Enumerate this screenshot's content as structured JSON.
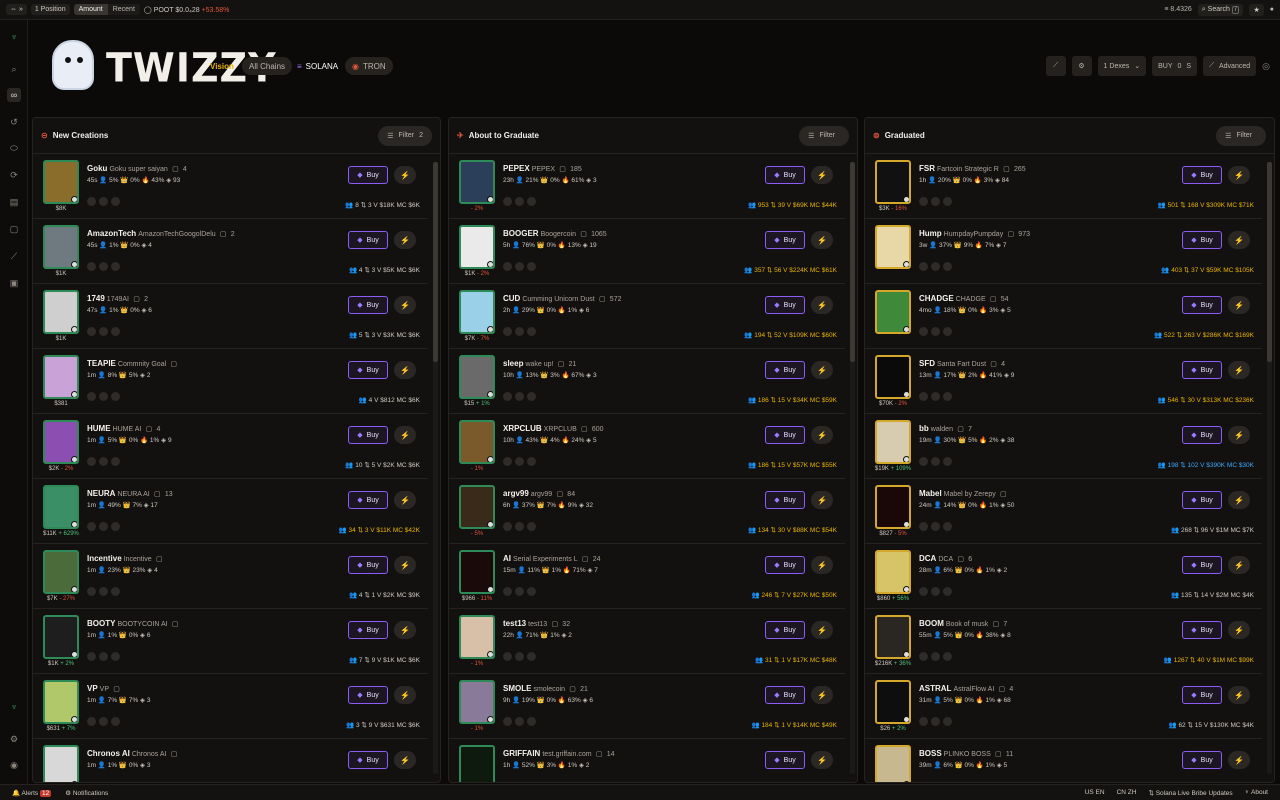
{
  "topbar": {
    "positions": "1 Position",
    "seg_amount": "Amount",
    "seg_recent": "Recent",
    "ticker": "POOT $0.0₄28",
    "ticker_change": "+53.58%",
    "balance": "8.4326",
    "search": "Search",
    "search_key": "/"
  },
  "brand": {
    "title": "TWIZZY",
    "sub": "Vision"
  },
  "chains": {
    "all": "All Chains",
    "sol": "SOLANA",
    "tron": "TRON"
  },
  "controls": {
    "dexes": "1  Dexes",
    "buy": "BUY",
    "amount": "0",
    "unit": "S",
    "advanced": "Advanced"
  },
  "columns": [
    {
      "title": "New Creations",
      "filter": "Filter",
      "filter_count": "2",
      "cards": [
        {
          "ticker": "Goku",
          "name": "Goku super saiyan",
          "holders": "4",
          "stats": "45s  👤 5%  👑 0%  🔥 43%  ◈ 93",
          "price": "$8K",
          "chg": "",
          "metrics": "👥 8  ⇅ 3  V $18K  MC $6K",
          "thumb": "#8a6d2a",
          "mcc": ""
        },
        {
          "ticker": "AmazonTech",
          "name": "AmazonTechGoogolDelu",
          "holders": "2",
          "stats": "45s  👤 1%  👑 0%  ◈ 4",
          "price": "$1K",
          "chg": "",
          "metrics": "👥 4  ⇅ 3  V $5K  MC $6K",
          "thumb": "#6e7a80",
          "mcc": ""
        },
        {
          "ticker": "1749",
          "name": "1749AI",
          "holders": "2",
          "stats": "47s  👤 1%  👑 0%  ◈ 6",
          "price": "$1K",
          "chg": "",
          "metrics": "👥 5  ⇅ 3  V $3K  MC $6K",
          "thumb": "#cfcfcf",
          "mcc": ""
        },
        {
          "ticker": "TEAPIE",
          "name": "Commnity Goal",
          "holders": "",
          "stats": "1m  👤 8%  👑 5%  ◈ 2",
          "price": "$381",
          "chg": "",
          "metrics": "👥 4  V $812  MC $6K",
          "thumb": "#c9a3d8",
          "mcc": ""
        },
        {
          "ticker": "HUME",
          "name": "HUME AI",
          "holders": "4",
          "stats": "1m  👤 5%  👑 0%  🔥 1%  ◈ 9",
          "price": "$2K",
          "chg": "- 2%",
          "metrics": "👥 10  ⇅ 5  V $2K  MC $6K",
          "thumb": "#8a4fb0",
          "mcc": ""
        },
        {
          "ticker": "NEURA",
          "name": "NEURA AI",
          "holders": "13",
          "stats": "1m  👤 49%  👑 7%  ◈ 17",
          "price": "$11K",
          "chg": "+ 629%",
          "metrics": "👥 34  ⇅ 3  V $11K  MC $42K",
          "thumb": "#3a8f66",
          "mcc": "gold"
        },
        {
          "ticker": "Incentive",
          "name": "Incentive",
          "holders": "",
          "stats": "1m  👤 23%  👑 23%  ◈ 4",
          "price": "$7K",
          "chg": "- 27%",
          "metrics": "👥 4  ⇅ 1  V $2K  MC $9K",
          "thumb": "#4c6b3a",
          "mcc": ""
        },
        {
          "ticker": "BOOTY",
          "name": "BOOTYCOIN AI",
          "holders": "",
          "stats": "1m  👤 1%  👑 0%  ◈ 6",
          "price": "$1K",
          "chg": "+ 2%",
          "metrics": "👥 7  ⇅ 9  V $1K  MC $6K",
          "thumb": "#1e1e1e",
          "mcc": ""
        },
        {
          "ticker": "VP",
          "name": "VP",
          "holders": "",
          "stats": "1m  👤 7%  👑 7%  ◈ 3",
          "price": "$631",
          "chg": "+ 7%",
          "metrics": "👥 3  ⇅ 9  V $631  MC $6K",
          "thumb": "#b0c86a",
          "mcc": ""
        },
        {
          "ticker": "Chronos AI",
          "name": "Chronos AI",
          "holders": "",
          "stats": "1m  👤 1%  👑 0%  ◈ 3",
          "price": "",
          "chg": "",
          "metrics": "",
          "thumb": "#d8d8d8",
          "mcc": ""
        }
      ]
    },
    {
      "title": "About to Graduate",
      "filter": "Filter",
      "filter_count": "",
      "cards": [
        {
          "ticker": "PEPEX",
          "name": "PEPEX",
          "holders": "185",
          "stats": "23h  👤 21%  👑 0%  🔥 61%  ◈ 3",
          "price": "",
          "chg": "- 2%",
          "metrics": "👥 953  ⇅ 39  V $69K  MC $44K",
          "thumb": "#2b3f5a",
          "mcc": "gold"
        },
        {
          "ticker": "BOOGER",
          "name": "Boogercoin",
          "holders": "1065",
          "stats": "5h  👤 76%  👑 0%  🔥 13%  ◈ 19",
          "price": "$1K",
          "chg": "- 2%",
          "metrics": "👥 357  ⇅ 56  V $224K  MC $61K",
          "thumb": "#eaeaea",
          "mcc": "gold"
        },
        {
          "ticker": "CUD",
          "name": "Cumming Unicorn Dust",
          "holders": "572",
          "stats": "2h  👤 29%  👑 0%  🔥 1%  ◈ 6",
          "price": "$7K",
          "chg": "- 7%",
          "metrics": "👥 194  ⇅ 52  V $109K  MC $60K",
          "thumb": "#9ad0e8",
          "mcc": "gold"
        },
        {
          "ticker": "sleep",
          "name": "wake up!",
          "holders": "21",
          "stats": "10h  👤 13%  👑 3%  🔥 67%  ◈ 3",
          "price": "$15",
          "chg": "+ 1%",
          "metrics": "👥 186  ⇅ 15  V $34K  MC $59K",
          "thumb": "#6a6a6a",
          "mcc": "gold"
        },
        {
          "ticker": "XRPCLUB",
          "name": "XRPCLUB",
          "holders": "600",
          "stats": "10h  👤 43%  👑 4%  🔥 24%  ◈ 5",
          "price": "",
          "chg": "- 1%",
          "metrics": "👥 186  ⇅ 15  V $57K  MC $55K",
          "thumb": "#7a5a2a",
          "mcc": "gold"
        },
        {
          "ticker": "argv99",
          "name": "argv99",
          "holders": "84",
          "stats": "6h  👤 37%  👑 7%  🔥 9%  ◈ 32",
          "price": "",
          "chg": "- 5%",
          "metrics": "👥 134  ⇅ 30  V $88K  MC $54K",
          "thumb": "#3a2a1a",
          "mcc": "gold"
        },
        {
          "ticker": "AI",
          "name": "Serial Experiments L",
          "holders": "24",
          "stats": "15m  👤 11%  👑 1%  🔥 71%  ◈ 7",
          "price": "$966",
          "chg": "- 11%",
          "metrics": "👥 246  ⇅ 7  V $27K  MC $50K",
          "thumb": "#1a0a0a",
          "mcc": "gold"
        },
        {
          "ticker": "test13",
          "name": "test13",
          "holders": "32",
          "stats": "22h  👤 71%  👑 1%  ◈ 2",
          "price": "",
          "chg": "- 1%",
          "metrics": "👥 31  ⇅ 1  V $17K  MC $48K",
          "thumb": "#d8c0a8",
          "mcc": "gold"
        },
        {
          "ticker": "SMOLE",
          "name": "smolecoin",
          "holders": "21",
          "stats": "9h  👤 19%  👑 0%  🔥 63%  ◈ 6",
          "price": "",
          "chg": "- 1%",
          "metrics": "👥 184  ⇅ 1  V $14K  MC $49K",
          "thumb": "#8a7a9a",
          "mcc": "gold"
        },
        {
          "ticker": "GRIFFAIN",
          "name": "test.griffain.com",
          "holders": "14",
          "stats": "1h  👤 52%  👑 3%  🔥 1%  ◈ 2",
          "price": "",
          "chg": "",
          "metrics": "",
          "thumb": "#0e1a0e",
          "mcc": ""
        }
      ]
    },
    {
      "title": "Graduated",
      "filter": "Filter",
      "filter_count": "",
      "cards": [
        {
          "ticker": "FSR",
          "name": "Fartcoin Strategic R",
          "holders": "265",
          "stats": "1h  👤 20%  👑 0%  🔥 3%  ◈ 84",
          "price": "$3K",
          "chg": "- 16%",
          "metrics": "👥 501  ⇅ 168  V $309K  MC $71K",
          "thumb": "#111111",
          "mcc": "gold"
        },
        {
          "ticker": "Hump",
          "name": "HumpdayPumpday",
          "holders": "973",
          "stats": "3w  👤 37%  👑 9%  🔥 7%  ◈ 7",
          "price": "",
          "chg": "",
          "metrics": "👥 403  ⇅ 37  V $59K  MC $105K",
          "thumb": "#e8d8a8",
          "mcc": "gold"
        },
        {
          "ticker": "CHADGE",
          "name": "CHADGE",
          "holders": "54",
          "stats": "4mo  👤 18%  👑 0%  🔥 3%  ◈ 5",
          "price": "",
          "chg": "",
          "metrics": "👥 522  ⇅ 263  V $286K  MC $169K",
          "thumb": "#3e8a3a",
          "mcc": "gold"
        },
        {
          "ticker": "SFD",
          "name": "Santa Fart Dust",
          "holders": "4",
          "stats": "13m  👤 17%  👑 2%  🔥 41%  ◈ 9",
          "price": "$70K",
          "chg": "- 2%",
          "metrics": "👥 546  ⇅ 30  V $313K  MC $236K",
          "thumb": "#0a0a0a",
          "mcc": "gold"
        },
        {
          "ticker": "bb",
          "name": "walden",
          "holders": "7",
          "stats": "19m  👤 30%  👑 5%  🔥 2%  ◈ 38",
          "price": "$19K",
          "chg": "+ 109%",
          "metrics": "👥 198  ⇅ 102  V $390K  MC $30K",
          "thumb": "#d8ccb0",
          "mcc": "blue"
        },
        {
          "ticker": "Mabel",
          "name": "Mabel by Zerepy",
          "holders": "",
          "stats": "24m  👤 14%  👑 0%  🔥 1%  ◈ 50",
          "price": "$827",
          "chg": "- 5%",
          "metrics": "👥 268  ⇅ 96  V $1M  MC $7K",
          "thumb": "#1a0808",
          "mcc": ""
        },
        {
          "ticker": "DCA",
          "name": "DCA",
          "holders": "6",
          "stats": "28m  👤 6%  👑 0%  🔥 1%  ◈ 2",
          "price": "$860",
          "chg": "+ 56%",
          "metrics": "👥 135  ⇅ 14  V $2M  MC $4K",
          "thumb": "#d8c468",
          "mcc": ""
        },
        {
          "ticker": "BOOM",
          "name": "Book of musk",
          "holders": "7",
          "stats": "55m  👤 5%  👑 0%  🔥 38%  ◈ 8",
          "price": "$216K",
          "chg": "+ 36%",
          "metrics": "👥 1267  ⇅ 40  V $1M  MC $99K",
          "thumb": "#2a2622",
          "mcc": "gold"
        },
        {
          "ticker": "ASTRAL",
          "name": "AstralFlow AI",
          "holders": "4",
          "stats": "31m  👤 5%  👑 0%  🔥 1%  ◈ 68",
          "price": "$26",
          "chg": "+ 2%",
          "metrics": "👥 62  ⇅ 15  V $130K  MC $4K",
          "thumb": "#0e0e0e",
          "mcc": ""
        },
        {
          "ticker": "BOSS",
          "name": "PLINKO BOSS",
          "holders": "11",
          "stats": "39m  👤 6%  👑 0%  🔥 1%  ◈ 5",
          "price": "",
          "chg": "",
          "metrics": "",
          "thumb": "#c8b890",
          "mcc": ""
        }
      ]
    }
  ],
  "card_labels": {
    "buy": "Buy",
    "bolt": "⚡"
  },
  "footer": {
    "alerts": "Alerts",
    "alerts_count": "12",
    "notifications": "Notifications",
    "lang1": "US EN",
    "lang2": "CN ZH",
    "live": "Solana Live Bribe Updates",
    "about": "About"
  },
  "colors": {
    "accent": "#8b5cf6",
    "gold": "#e8b400",
    "green": "#2e8b57",
    "red": "#e0563b"
  }
}
